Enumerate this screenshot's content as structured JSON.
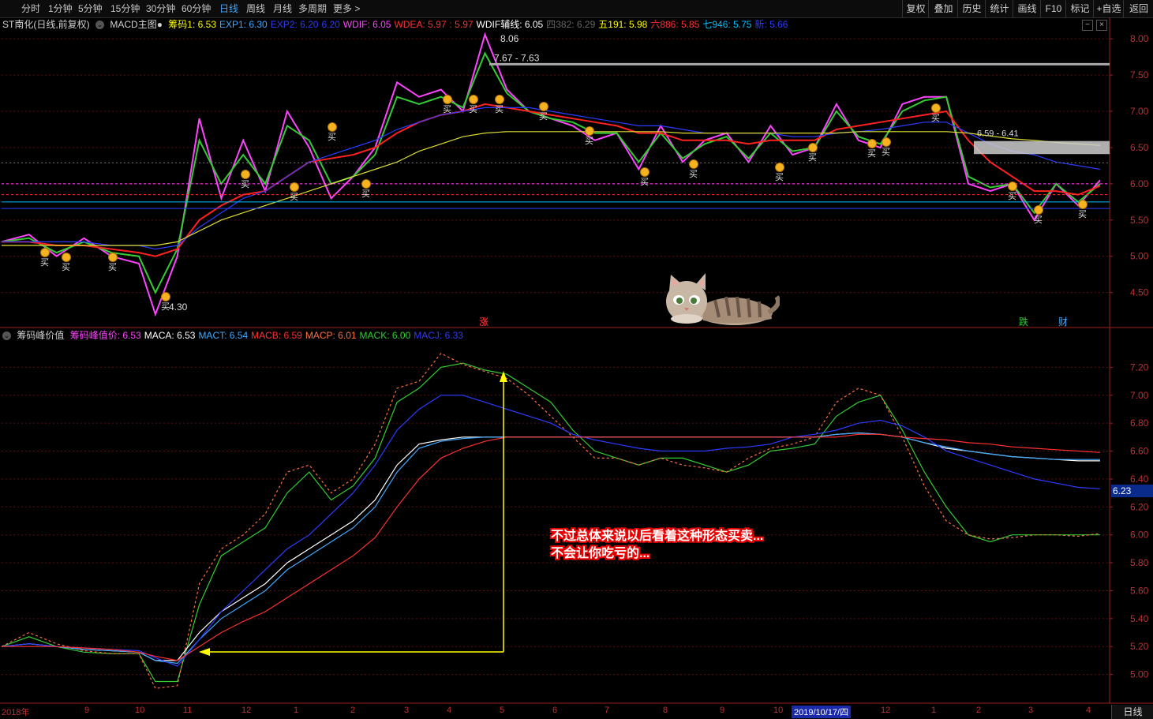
{
  "toolbar": {
    "timeframes": [
      "分时",
      "1分钟",
      "5分钟",
      "15分钟",
      "30分钟",
      "60分钟",
      "日线",
      "周线",
      "月线",
      "多周期",
      "更多 >"
    ],
    "active_timeframe": "日线",
    "right_buttons": [
      "复权",
      "叠加",
      "历史",
      "统计",
      "画线",
      "F10",
      "标记",
      "+自选",
      "返回"
    ]
  },
  "main_panel": {
    "title": "ST南化(日线,前复权)",
    "indicator": "MACD主图●",
    "legend": [
      {
        "label": "筹码1: 6.53",
        "color": "#ffff00"
      },
      {
        "label": "EXP1: 6.30",
        "color": "#3fa9ff"
      },
      {
        "label": "EXP2: 6.20",
        "color": "#2b3cff"
      },
      {
        "label": "6.20",
        "color": "#2b3cff"
      },
      {
        "label": "WDIF: 6.05",
        "color": "#ff44ff"
      },
      {
        "label": "WDEA: 5.97",
        "color": "#ff3030"
      },
      {
        "label": ": 5.97",
        "color": "#ff3030"
      },
      {
        "label": "WDIF辅线: 6.05",
        "color": "#ffffff"
      },
      {
        "label": "四382: 6.29",
        "color": "#666666"
      },
      {
        "label": "五191: 5.98",
        "color": "#ffff00"
      },
      {
        "label": "六886: 5.85",
        "color": "#ff3030"
      },
      {
        "label": "七946: 5.75",
        "color": "#00c0ff"
      },
      {
        "label": "新: 5.66",
        "color": "#2b3cff"
      }
    ],
    "markers": {
      "high_price": "8.06",
      "range_label": "7.67 - 7.63",
      "low_price": "4.30",
      "gap_label": "6.59 - 6.41"
    },
    "event_labels": [
      "涨",
      "跌",
      "财"
    ],
    "buy_label": "买"
  },
  "sub_panel": {
    "title": "筹码峰价值",
    "legend": [
      {
        "label": "筹码峰值价: 6.53",
        "color": "#ff44ff"
      },
      {
        "label": "MACA: 6.53",
        "color": "#ffffff"
      },
      {
        "label": "MACT: 6.54",
        "color": "#3fa9ff"
      },
      {
        "label": "MACB: 6.59",
        "color": "#ff3030"
      },
      {
        "label": "MACP: 6.01",
        "color": "#ff7040"
      },
      {
        "label": "MACK: 6.00",
        "color": "#33cc33"
      },
      {
        "label": "MACJ: 6.33",
        "color": "#2b3cff"
      }
    ],
    "current_value": "6.23",
    "annotation_line1": "不过总体来说以后看着这种形态买卖...",
    "annotation_line2": "不会让你吃亏的..."
  },
  "x_axis": {
    "labels": [
      "2018年",
      "9",
      "10",
      "11",
      "12",
      "1",
      "2",
      "3",
      "4",
      "5",
      "6",
      "7",
      "8",
      "9",
      "10",
      "2019/10/17/四",
      "12",
      "1",
      "2",
      "3",
      "4"
    ],
    "period_button": "日线"
  },
  "chart_data": [
    {
      "type": "line",
      "name": "main",
      "y_ticks": [
        8.0,
        7.5,
        7.0,
        6.5,
        6.0,
        5.5,
        5.0,
        4.5
      ],
      "ylim": [
        4.05,
        8.1
      ],
      "grid": true,
      "x": [
        0,
        0.025,
        0.05,
        0.075,
        0.1,
        0.125,
        0.14,
        0.16,
        0.18,
        0.2,
        0.22,
        0.24,
        0.26,
        0.28,
        0.3,
        0.32,
        0.34,
        0.36,
        0.38,
        0.4,
        0.42,
        0.44,
        0.46,
        0.48,
        0.5,
        0.52,
        0.54,
        0.56,
        0.58,
        0.6,
        0.62,
        0.64,
        0.66,
        0.68,
        0.7,
        0.72,
        0.74,
        0.76,
        0.78,
        0.8,
        0.82,
        0.84,
        0.86,
        0.88,
        0.9,
        0.92,
        0.94,
        0.96,
        0.98,
        1.0
      ],
      "series": [
        {
          "color": "#ff44ff",
          "values": [
            5.2,
            5.3,
            5.0,
            5.25,
            5.0,
            4.9,
            4.2,
            5.0,
            6.9,
            5.8,
            6.6,
            5.9,
            7.0,
            6.5,
            5.8,
            6.1,
            6.5,
            7.4,
            7.2,
            7.3,
            7.0,
            8.06,
            7.3,
            7.0,
            6.9,
            6.8,
            6.6,
            6.7,
            6.2,
            6.8,
            6.3,
            6.6,
            6.7,
            6.3,
            6.8,
            6.4,
            6.5,
            7.1,
            6.6,
            6.5,
            7.1,
            7.2,
            7.2,
            6.0,
            5.9,
            6.0,
            5.5,
            6.0,
            5.7,
            6.05
          ]
        },
        {
          "color": "#33cc33",
          "values": [
            5.2,
            5.25,
            5.05,
            5.2,
            5.05,
            5.0,
            4.5,
            5.1,
            6.6,
            6.0,
            6.4,
            6.0,
            6.8,
            6.6,
            6.0,
            6.1,
            6.4,
            7.2,
            7.1,
            7.2,
            7.05,
            7.8,
            7.25,
            7.0,
            6.9,
            6.85,
            6.7,
            6.7,
            6.3,
            6.7,
            6.35,
            6.55,
            6.65,
            6.35,
            6.7,
            6.45,
            6.5,
            7.0,
            6.65,
            6.55,
            7.0,
            7.15,
            7.2,
            6.1,
            5.95,
            6.0,
            5.6,
            6.0,
            5.75,
            6.0
          ]
        },
        {
          "color": "#ff2020",
          "values": [
            5.2,
            5.2,
            5.15,
            5.15,
            5.1,
            5.05,
            5.0,
            5.1,
            5.5,
            5.7,
            5.85,
            5.9,
            6.1,
            6.3,
            6.35,
            6.4,
            6.5,
            6.7,
            6.85,
            6.95,
            7.0,
            7.1,
            7.05,
            7.0,
            6.95,
            6.9,
            6.85,
            6.8,
            6.7,
            6.7,
            6.6,
            6.6,
            6.6,
            6.55,
            6.6,
            6.6,
            6.6,
            6.75,
            6.8,
            6.85,
            6.9,
            6.95,
            7.0,
            6.6,
            6.3,
            6.1,
            5.9,
            5.9,
            5.85,
            5.97
          ]
        },
        {
          "color": "#2b3cff",
          "values": [
            5.2,
            5.2,
            5.2,
            5.2,
            5.15,
            5.15,
            5.1,
            5.15,
            5.4,
            5.6,
            5.8,
            5.9,
            6.1,
            6.3,
            6.4,
            6.5,
            6.6,
            6.75,
            6.85,
            6.95,
            7.0,
            7.05,
            7.05,
            7.05,
            7.0,
            6.95,
            6.9,
            6.85,
            6.8,
            6.8,
            6.75,
            6.7,
            6.7,
            6.7,
            6.7,
            6.65,
            6.65,
            6.7,
            6.72,
            6.75,
            6.8,
            6.85,
            6.85,
            6.7,
            6.55,
            6.45,
            6.4,
            6.3,
            6.25,
            6.2
          ]
        },
        {
          "color": "#dddd33",
          "values": [
            5.15,
            5.15,
            5.15,
            5.15,
            5.15,
            5.15,
            5.15,
            5.2,
            5.35,
            5.5,
            5.6,
            5.7,
            5.8,
            5.9,
            6.0,
            6.1,
            6.2,
            6.3,
            6.45,
            6.55,
            6.65,
            6.7,
            6.72,
            6.72,
            6.72,
            6.72,
            6.72,
            6.72,
            6.72,
            6.72,
            6.7,
            6.7,
            6.7,
            6.7,
            6.7,
            6.7,
            6.7,
            6.7,
            6.72,
            6.72,
            6.72,
            6.72,
            6.72,
            6.7,
            6.66,
            6.62,
            6.6,
            6.57,
            6.55,
            6.53
          ]
        }
      ]
    },
    {
      "type": "line",
      "name": "sub",
      "y_ticks": [
        7.2,
        7.0,
        6.8,
        6.6,
        6.4,
        6.2,
        6.0,
        5.8,
        5.6,
        5.4,
        5.2,
        5.0
      ],
      "ylim": [
        4.8,
        7.4
      ],
      "grid": true,
      "x": [
        0,
        0.025,
        0.05,
        0.075,
        0.1,
        0.125,
        0.14,
        0.16,
        0.18,
        0.2,
        0.22,
        0.24,
        0.26,
        0.28,
        0.3,
        0.32,
        0.34,
        0.36,
        0.38,
        0.4,
        0.42,
        0.44,
        0.46,
        0.48,
        0.5,
        0.52,
        0.54,
        0.56,
        0.58,
        0.6,
        0.62,
        0.64,
        0.66,
        0.68,
        0.7,
        0.72,
        0.74,
        0.76,
        0.78,
        0.8,
        0.82,
        0.84,
        0.86,
        0.88,
        0.9,
        0.92,
        0.94,
        0.96,
        0.98,
        1.0
      ],
      "series": [
        {
          "color": "#33cc33",
          "values": [
            5.2,
            5.27,
            5.2,
            5.16,
            5.15,
            5.15,
            4.95,
            4.95,
            5.5,
            5.85,
            5.95,
            6.05,
            6.3,
            6.45,
            6.25,
            6.35,
            6.55,
            6.95,
            7.05,
            7.2,
            7.23,
            7.18,
            7.15,
            7.05,
            6.95,
            6.75,
            6.6,
            6.55,
            6.5,
            6.55,
            6.55,
            6.5,
            6.45,
            6.5,
            6.6,
            6.62,
            6.65,
            6.85,
            6.95,
            7.0,
            6.75,
            6.45,
            6.2,
            6.0,
            5.95,
            6.0,
            6.0,
            6.0,
            6.0,
            6.0
          ]
        },
        {
          "color": "#ff7040",
          "values": [
            5.2,
            5.3,
            5.22,
            5.17,
            5.15,
            5.15,
            4.9,
            4.92,
            5.65,
            5.9,
            6.0,
            6.15,
            6.45,
            6.5,
            6.3,
            6.4,
            6.65,
            7.05,
            7.1,
            7.3,
            7.22,
            7.17,
            7.12,
            7.0,
            6.85,
            6.7,
            6.55,
            6.55,
            6.5,
            6.55,
            6.5,
            6.48,
            6.45,
            6.55,
            6.62,
            6.65,
            6.7,
            6.95,
            7.05,
            7.0,
            6.7,
            6.35,
            6.1,
            6.0,
            5.97,
            5.98,
            6.0,
            6.0,
            5.99,
            6.01
          ]
        },
        {
          "color": "#ffffff",
          "values": [
            5.2,
            5.22,
            5.2,
            5.18,
            5.17,
            5.16,
            5.1,
            5.1,
            5.3,
            5.45,
            5.55,
            5.65,
            5.8,
            5.9,
            6.0,
            6.1,
            6.25,
            6.5,
            6.65,
            6.68,
            6.7,
            6.7,
            6.7,
            6.7,
            6.7,
            6.7,
            6.7,
            6.7,
            6.7,
            6.7,
            6.7,
            6.7,
            6.7,
            6.7,
            6.7,
            6.7,
            6.7,
            6.72,
            6.73,
            6.72,
            6.7,
            6.66,
            6.62,
            6.6,
            6.58,
            6.56,
            6.55,
            6.54,
            6.53,
            6.53
          ]
        },
        {
          "color": "#3fa9ff",
          "values": [
            5.2,
            5.22,
            5.2,
            5.18,
            5.17,
            5.16,
            5.1,
            5.08,
            5.25,
            5.4,
            5.5,
            5.6,
            5.75,
            5.85,
            5.95,
            6.05,
            6.2,
            6.45,
            6.62,
            6.67,
            6.69,
            6.7,
            6.7,
            6.7,
            6.7,
            6.7,
            6.7,
            6.7,
            6.7,
            6.7,
            6.7,
            6.7,
            6.7,
            6.7,
            6.7,
            6.7,
            6.7,
            6.72,
            6.73,
            6.72,
            6.7,
            6.66,
            6.63,
            6.6,
            6.58,
            6.56,
            6.55,
            6.54,
            6.54,
            6.54
          ]
        },
        {
          "color": "#2b3cff",
          "values": [
            5.2,
            5.22,
            5.2,
            5.19,
            5.18,
            5.17,
            5.12,
            5.06,
            5.25,
            5.45,
            5.6,
            5.75,
            5.9,
            6.0,
            6.15,
            6.3,
            6.5,
            6.75,
            6.9,
            7.0,
            7.0,
            6.95,
            6.9,
            6.85,
            6.8,
            6.72,
            6.68,
            6.65,
            6.62,
            6.6,
            6.6,
            6.6,
            6.62,
            6.63,
            6.65,
            6.7,
            6.72,
            6.75,
            6.8,
            6.82,
            6.78,
            6.7,
            6.6,
            6.55,
            6.5,
            6.45,
            6.4,
            6.37,
            6.34,
            6.33
          ]
        },
        {
          "color": "#ff3030",
          "values": [
            5.2,
            5.2,
            5.2,
            5.19,
            5.18,
            5.16,
            5.13,
            5.1,
            5.2,
            5.3,
            5.38,
            5.45,
            5.55,
            5.65,
            5.75,
            5.85,
            5.98,
            6.2,
            6.4,
            6.55,
            6.62,
            6.67,
            6.7,
            6.7,
            6.7,
            6.7,
            6.7,
            6.7,
            6.7,
            6.7,
            6.7,
            6.7,
            6.7,
            6.7,
            6.7,
            6.7,
            6.7,
            6.7,
            6.72,
            6.72,
            6.7,
            6.69,
            6.68,
            6.66,
            6.65,
            6.63,
            6.62,
            6.61,
            6.6,
            6.59
          ]
        }
      ]
    }
  ]
}
